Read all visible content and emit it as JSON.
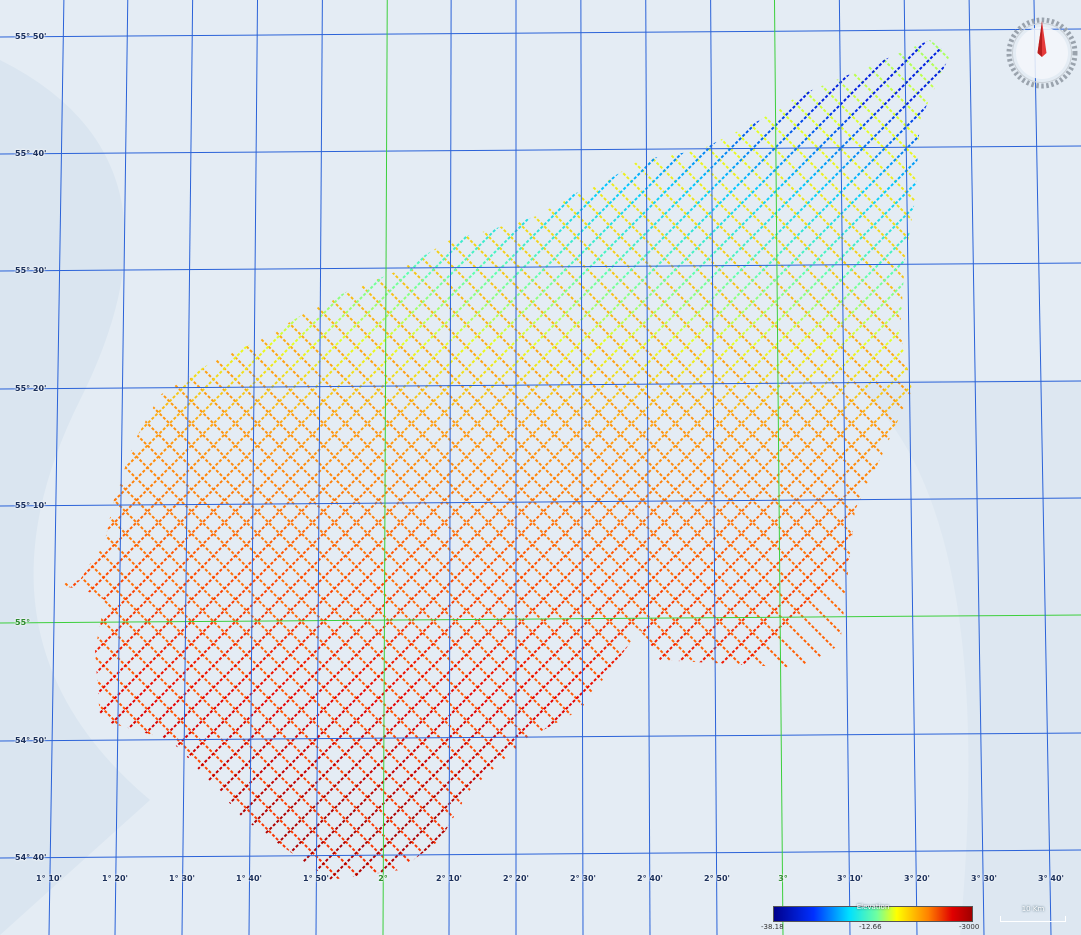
{
  "map": {
    "lat_labels": [
      "55° 50'",
      "55° 40'",
      "55° 30'",
      "55° 20'",
      "55° 10'",
      "55°",
      "54° 50'",
      "54° 40'"
    ],
    "lon_labels": [
      "1° 10'",
      "1° 20'",
      "1° 30'",
      "1° 40'",
      "1° 50'",
      "2°",
      "2° 10'",
      "2° 20'",
      "2° 30'",
      "2° 40'",
      "2° 50'",
      "3°",
      "3° 10'",
      "3° 20'",
      "3° 30'",
      "3° 40'"
    ],
    "colors": {
      "grid": "#2a62d8",
      "major_grid": "#3ccf3c",
      "sea": "#e4ecf4"
    }
  },
  "legend": {
    "title": "Elevation",
    "min_label": "-38.18",
    "mid_label": "-12.66",
    "max_label": "-3000",
    "colors": [
      "#00008c",
      "#0030ff",
      "#00e0ff",
      "#70ffa0",
      "#ffff00",
      "#ff8000",
      "#e00000",
      "#a00000"
    ]
  },
  "scale_bar": {
    "label": "10 Km"
  },
  "compass": {
    "icon": "compass-rose-icon"
  }
}
